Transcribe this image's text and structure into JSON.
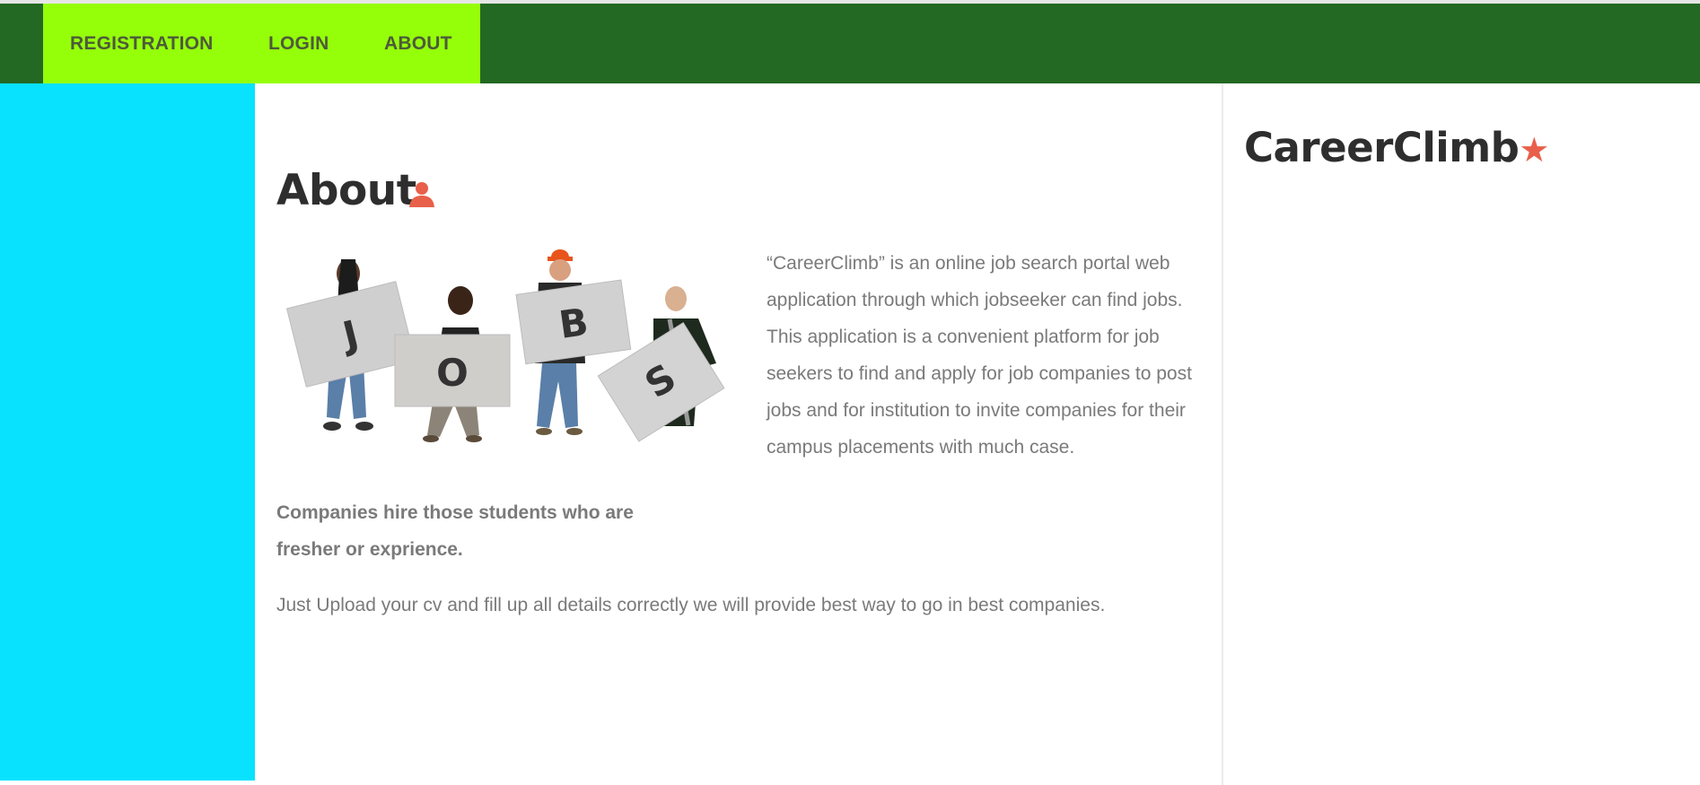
{
  "nav": {
    "items": [
      {
        "label": "REGISTRATION"
      },
      {
        "label": "LOGIN"
      },
      {
        "label": "ABOUT"
      }
    ]
  },
  "main": {
    "title": "About",
    "title_icon": "user-icon",
    "image_letters": [
      "J",
      "O",
      "B",
      "S"
    ],
    "description": "“CareerClimb” is an online job search portal web application through which jobseeker can find jobs. This application is a convenient platform for job seekers to find and apply for job companies to post jobs and for institution to invite companies for their campus placements with much case.",
    "bold_text": "Companies hire those students who are fresher or exprience.",
    "upload_text": "Just Upload your cv and fill up all details correctly we will provide best way to go in best companies."
  },
  "sidebar": {
    "brand": "CareerClimb",
    "brand_star": "★"
  },
  "colors": {
    "navbar": "#236923",
    "menu": "#95ff0a",
    "left_panel": "#08e2ff",
    "accent": "#e8604a"
  }
}
